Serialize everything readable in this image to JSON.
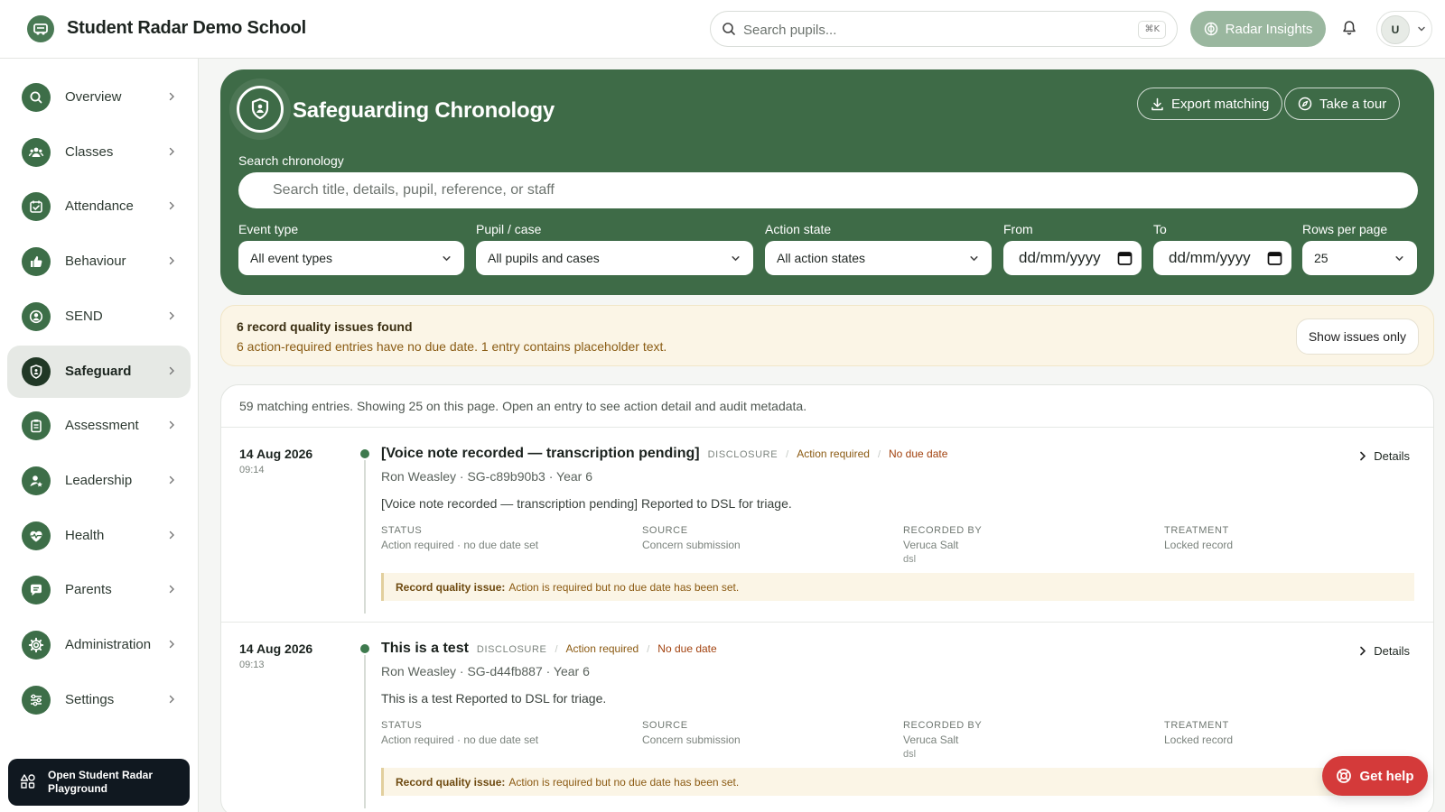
{
  "topbar": {
    "school_name": "Student Radar Demo School",
    "search_placeholder": "Search pupils...",
    "search_shortcut": "⌘K",
    "insights_label": "Radar Insights",
    "user_initial": "U"
  },
  "sidebar": {
    "items": [
      {
        "label": "Overview",
        "icon": "search-icon"
      },
      {
        "label": "Classes",
        "icon": "users-icon"
      },
      {
        "label": "Attendance",
        "icon": "calendar-check-icon"
      },
      {
        "label": "Behaviour",
        "icon": "thumbs-up-icon"
      },
      {
        "label": "SEND",
        "icon": "person-circle-icon"
      },
      {
        "label": "Safeguard",
        "icon": "shield-icon",
        "active": true
      },
      {
        "label": "Assessment",
        "icon": "clipboard-icon"
      },
      {
        "label": "Leadership",
        "icon": "user-star-icon"
      },
      {
        "label": "Health",
        "icon": "heart-pulse-icon"
      },
      {
        "label": "Parents",
        "icon": "chat-icon"
      },
      {
        "label": "Administration",
        "icon": "gear-icon"
      },
      {
        "label": "Settings",
        "icon": "sliders-icon"
      }
    ],
    "playground_label": "Open Student Radar Playground"
  },
  "hero": {
    "title": "Safeguarding Chronology",
    "export_label": "Export matching",
    "tour_label": "Take a tour",
    "search_label": "Search chronology",
    "search_placeholder": "Search title, details, pupil, reference, or staff",
    "filters": {
      "event_type": {
        "label": "Event type",
        "value": "All event types"
      },
      "pupil_case": {
        "label": "Pupil / case",
        "value": "All pupils and cases"
      },
      "action_state": {
        "label": "Action state",
        "value": "All action states"
      },
      "from": {
        "label": "From",
        "value": "dd/mm/yyyy"
      },
      "to": {
        "label": "To",
        "value": "dd/mm/yyyy"
      },
      "rows": {
        "label": "Rows per page",
        "value": "25"
      }
    }
  },
  "notice": {
    "title": "6 record quality issues found",
    "text": "6 action-required entries have no due date. 1 entry contains placeholder text.",
    "button": "Show issues only"
  },
  "list": {
    "summary": "59 matching entries. Showing 25 on this page. Open an entry to see action detail and audit metadata.",
    "meta_labels": {
      "status": "STATUS",
      "source": "SOURCE",
      "recorded_by": "RECORDED BY",
      "treatment": "TREATMENT"
    },
    "details_label": "Details",
    "entries": [
      {
        "date": "14 Aug 2026",
        "time": "09:14",
        "title": "[Voice note recorded — transcription pending]",
        "category": "DISCLOSURE",
        "tag_action": "Action required",
        "tag_due": "No due date",
        "subtitle": "Ron Weasley · SG-c89b90b3 · Year 6",
        "body": "[Voice note recorded — transcription pending] Reported to DSL for triage.",
        "status": "Action required · no due date set",
        "source": "Concern submission",
        "recorded_by": "Veruca Salt",
        "recorded_role": "dsl",
        "treatment": "Locked record",
        "issue_label": "Record quality issue:",
        "issue_text": "Action is required but no due date has been set."
      },
      {
        "date": "14 Aug 2026",
        "time": "09:13",
        "title": "This is a test",
        "category": "DISCLOSURE",
        "tag_action": "Action required",
        "tag_due": "No due date",
        "subtitle": "Ron Weasley · SG-d44fb887 · Year 6",
        "body": "This is a test Reported to DSL for triage.",
        "status": "Action required · no due date set",
        "source": "Concern submission",
        "recorded_by": "Veruca Salt",
        "recorded_role": "dsl",
        "treatment": "Locked record",
        "issue_label": "Record quality issue:",
        "issue_text": "Action is required but no due date has been set."
      }
    ]
  },
  "help_label": "Get help",
  "colors": {
    "brand_green": "#3e6b47",
    "warning_bg": "#fbf5e6",
    "help_red": "#d43a3a"
  }
}
